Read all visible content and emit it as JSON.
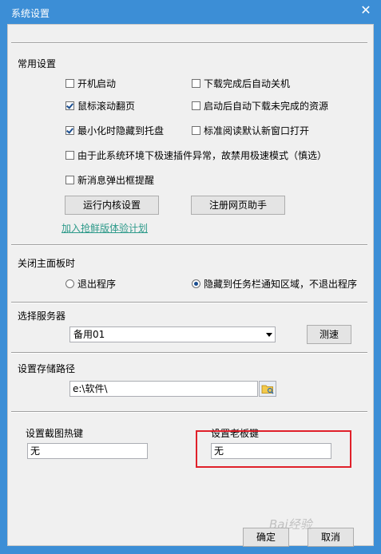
{
  "window": {
    "title": "系统设置",
    "close_glyph": "✕"
  },
  "common": {
    "label": "常用设置",
    "checkboxes": [
      {
        "label": "开机启动",
        "checked": false
      },
      {
        "label": "下载完成后自动关机",
        "checked": false
      },
      {
        "label": "鼠标滚动翻页",
        "checked": true
      },
      {
        "label": "启动后自动下载未完成的资源",
        "checked": false
      },
      {
        "label": "最小化时隐藏到托盘",
        "checked": true
      },
      {
        "label": "标准阅读默认新窗口打开",
        "checked": false
      },
      {
        "label": "由于此系统环境下极速插件异常，故禁用极速模式（慎选）",
        "checked": false
      },
      {
        "label": "新消息弹出框提醒",
        "checked": false
      }
    ],
    "kernel_button": "运行内核设置",
    "register_button": "注册网页助手",
    "beta_link": "加入抢鲜版体验计划"
  },
  "close_panel": {
    "label": "关闭主面板时",
    "options": [
      {
        "label": "退出程序",
        "checked": false
      },
      {
        "label": "隐藏到任务栏通知区域，不退出程序",
        "checked": true
      }
    ]
  },
  "server": {
    "label": "选择服务器",
    "selected": "备用01",
    "speed_button": "测速"
  },
  "storage": {
    "label": "设置存储路径",
    "path": "e:\\软件\\"
  },
  "hotkeys": {
    "screenshot_label": "设置截图热键",
    "screenshot_value": "无",
    "boss_label": "设置老板键",
    "boss_value": "无"
  },
  "footer": {
    "ok_button": "确定",
    "cancel_button": "取消"
  },
  "watermark": "Bai经验",
  "colors": {
    "title_bar": "#3c8ed6",
    "highlight": "#e0202a",
    "link": "#2e9a8a"
  }
}
